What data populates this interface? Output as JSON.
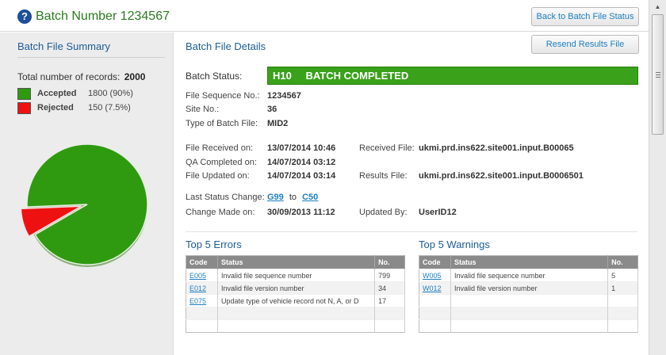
{
  "header": {
    "title": "Batch Number 1234567",
    "help_icon": "question-mark-icon",
    "back_button": "Back to Batch File Status"
  },
  "summary": {
    "title": "Batch File Summary",
    "total_label": "Total number of records:",
    "total_value": "2000",
    "legend": [
      {
        "label": "Accepted",
        "value": "1800 (90%)",
        "color": "#2f9a10"
      },
      {
        "label": "Rejected",
        "value": "150 (7.5%)",
        "color": "#ee1111"
      }
    ]
  },
  "chart_data": {
    "type": "pie",
    "categories": [
      "Accepted",
      "Rejected"
    ],
    "values": [
      1800,
      150
    ],
    "colors": [
      "#2f9a10",
      "#ee1111"
    ]
  },
  "details": {
    "title": "Batch File Details",
    "resend_button": "Resend Results File",
    "status_label": "Batch Status:",
    "status_code": "H10",
    "status_text": "BATCH COMPLETED",
    "status_color": "#39a11a",
    "file_sequence_label": "File Sequence No.:",
    "file_sequence_value": "1234567",
    "site_label": "Site No.:",
    "site_value": "36",
    "type_label": "Type of Batch File:",
    "type_value": "MID2",
    "received_label": "File Received on:",
    "received_value": "13/07/2014  10:46",
    "received_file_label": "Received File:",
    "received_file_value": "ukmi.prd.ins622.site001.input.B00065",
    "qa_label": "QA Completed on:",
    "qa_value": "14/07/2014  03:12",
    "updated_label": "File Updated on:",
    "updated_value": "14/07/2014  03:14",
    "results_file_label": "Results File:",
    "results_file_value": "ukmi.prd.ins622.site001.input.B0006501",
    "last_change_label": "Last Status Change:",
    "last_change_from": "G99",
    "last_change_to_word": "to",
    "last_change_to": "C50",
    "change_made_label": "Change Made on:",
    "change_made_value": "30/09/2013  11:12",
    "updated_by_label": "Updated By:",
    "updated_by_value": "UserID12"
  },
  "errors": {
    "title": "Top 5 Errors",
    "columns": [
      "Code",
      "Status",
      "No."
    ],
    "rows": [
      {
        "code": "E005",
        "status": "Invalid file sequence number",
        "no": "799"
      },
      {
        "code": "E012",
        "status": "Invalid file version number",
        "no": "34"
      },
      {
        "code": "E075",
        "status": "Update type of vehicle record not N, A, or D",
        "no": "17"
      },
      {
        "code": "",
        "status": "",
        "no": ""
      },
      {
        "code": "",
        "status": "",
        "no": ""
      }
    ]
  },
  "warnings": {
    "title": "Top 5 Warnings",
    "columns": [
      "Code",
      "Status",
      "No."
    ],
    "rows": [
      {
        "code": "W005",
        "status": "Invalid file sequence number",
        "no": "5"
      },
      {
        "code": "W012",
        "status": "Invalid file version number",
        "no": "1"
      },
      {
        "code": "",
        "status": "",
        "no": ""
      },
      {
        "code": "",
        "status": "",
        "no": ""
      },
      {
        "code": "",
        "status": "",
        "no": ""
      }
    ]
  }
}
